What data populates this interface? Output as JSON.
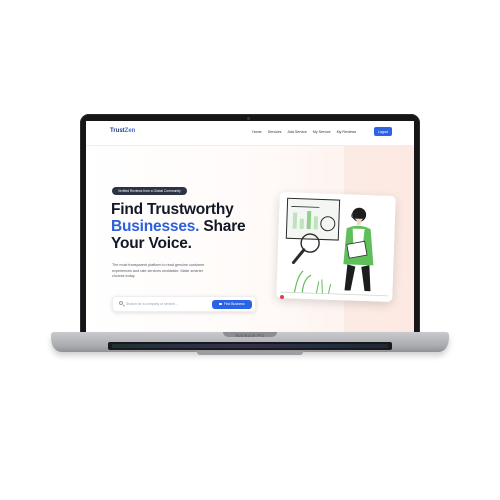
{
  "site": {
    "logo_primary": "Trust",
    "logo_accent": "Zen",
    "nav": [
      "Home",
      "Services",
      "Add Service",
      "My Service",
      "My Reviews"
    ],
    "login_label": "Logout"
  },
  "hero": {
    "badge": "Verified Reviews from a Global Community",
    "headline_line1": "Find Trustworthy",
    "headline_blue": "Businesses.",
    "headline_line2_rest": " Share",
    "headline_line3": "Your Voice.",
    "subtext": "The most transparent platform to read genuine customer experiences and rate services worldwide. Make smarter choices today.",
    "search_placeholder": "Search for a company or service...",
    "find_button": "Find Business"
  },
  "device": {
    "model_label": "MacBook Pro"
  },
  "colors": {
    "brand": "#2b63e6",
    "headline": "#121826",
    "illustration_accent": "#5fbf5a"
  }
}
